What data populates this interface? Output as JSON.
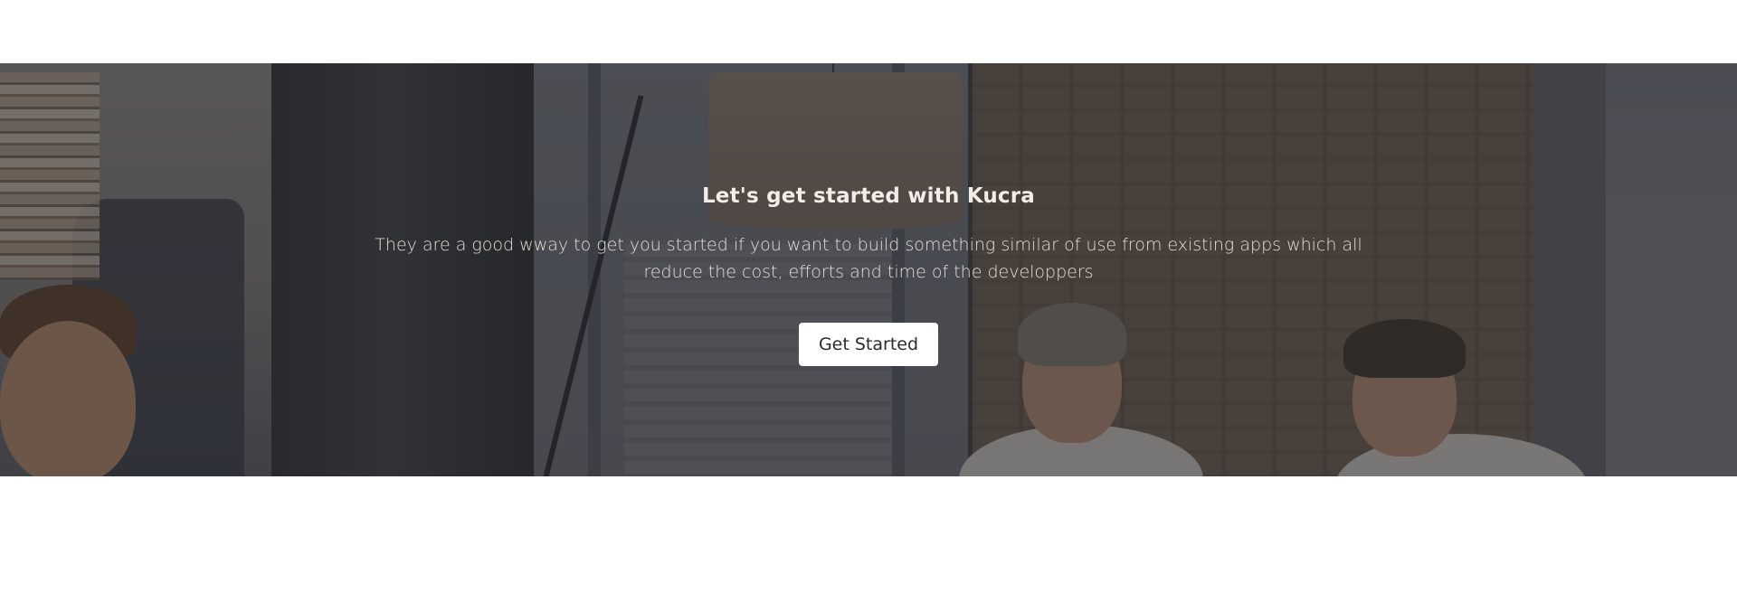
{
  "hero": {
    "title": "Let's get started with Kucra",
    "description": "They are a good wway to get you started if you want to build something similar of use from existing apps which all reduce the cost, efforts and time of the developpers",
    "cta_label": "Get Started"
  },
  "colors": {
    "page_background": "#ffffff",
    "overlay": "rgba(40,40,44,0.52)",
    "title_text": "#f2ede8",
    "description_text": "#e4ddd6",
    "button_background": "#ffffff",
    "button_text": "#2b2b2b"
  }
}
